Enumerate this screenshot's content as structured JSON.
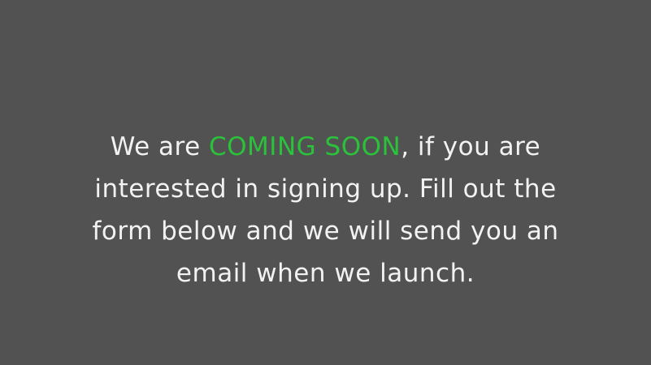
{
  "colors": {
    "background": "#525252",
    "text": "#f2f2f2",
    "accent": "#2bc23b"
  },
  "message": {
    "prefix": "We are ",
    "highlight": "COMING SOON",
    "line1_suffix": ", if you are",
    "line2": "interested in signing up. Fill out the",
    "line3": "form below and we will send you an",
    "line4": "email when we launch."
  }
}
